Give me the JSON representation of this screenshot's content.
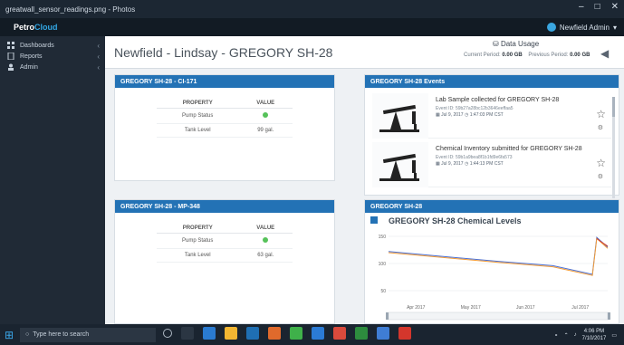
{
  "window": {
    "title": "greatwall_sensor_readings.png - Photos"
  },
  "app": {
    "logo_text": "Petro",
    "logo_text_accent": "Cloud",
    "user": "Newfield Admin"
  },
  "sidebar": {
    "items": [
      {
        "label": "Dashboards",
        "icon": "grid-icon"
      },
      {
        "label": "Reports",
        "icon": "document-icon"
      },
      {
        "label": "Admin",
        "icon": "user-icon"
      }
    ]
  },
  "page": {
    "title": "Newfield - Lindsay - GREGORY SH-28"
  },
  "usage": {
    "title": "Data Usage",
    "current_label": "Current Period:",
    "current_value": "0.00 GB",
    "previous_label": "Previous Period:",
    "previous_value": "0.00 GB"
  },
  "panel1": {
    "title": "GREGORY SH-28 - CI-171",
    "col_property": "PROPERTY",
    "col_value": "VALUE",
    "rows": [
      {
        "property": "Pump Status",
        "value": ""
      },
      {
        "property": "Tank Level",
        "value": "99 gal."
      }
    ]
  },
  "panel2": {
    "title": "GREGORY SH-28 - MP-348",
    "col_property": "PROPERTY",
    "col_value": "VALUE",
    "rows": [
      {
        "property": "Pump Status",
        "value": ""
      },
      {
        "property": "Tank Level",
        "value": "63 gal."
      }
    ]
  },
  "events": {
    "title": "GREGORY SH-28 Events",
    "items": [
      {
        "title": "Lab Sample collected for GREGORY SH-28",
        "event_id": "Event ID: 59b27a28bc12b3646eeffaa5",
        "date": "Jul 9, 2017",
        "time": "1:47:03 PM CST"
      },
      {
        "title": "Chemical Inventory submitted for GREGORY SH-28",
        "event_id": "Event ID: 59b1a9bea8f1b1fd9e6fa573",
        "date": "Jul 9, 2017",
        "time": "1:44:13 PM CST"
      }
    ]
  },
  "chart_panel": {
    "title": "GREGORY SH-28"
  },
  "taskbar": {
    "search_placeholder": "Type here to search",
    "time": "4:06 PM",
    "date": "7/10/2017"
  },
  "chart_data": {
    "type": "line",
    "title": "GREGORY SH-28 Chemical Levels",
    "x_ticks": [
      "Apr 2017",
      "May 2017",
      "Jun 2017",
      "Jul 2017"
    ],
    "y_ticks": [
      50,
      100,
      150
    ],
    "ylim": [
      30,
      160
    ],
    "series": [
      {
        "color": "#4a6fd2",
        "points": [
          [
            0,
            122
          ],
          [
            0.25,
            113
          ],
          [
            0.5,
            104
          ],
          [
            0.75,
            96
          ],
          [
            0.93,
            80
          ],
          [
            0.95,
            148
          ],
          [
            1,
            130
          ]
        ]
      },
      {
        "color": "#f29b36",
        "points": [
          [
            0,
            120
          ],
          [
            0.25,
            111
          ],
          [
            0.5,
            102
          ],
          [
            0.75,
            94
          ],
          [
            0.93,
            78
          ],
          [
            0.95,
            146
          ],
          [
            1,
            128
          ]
        ]
      },
      {
        "color": "#d6402f",
        "points": [
          [
            0.95,
            146
          ],
          [
            0.97,
            140
          ],
          [
            1,
            132
          ]
        ]
      }
    ]
  }
}
